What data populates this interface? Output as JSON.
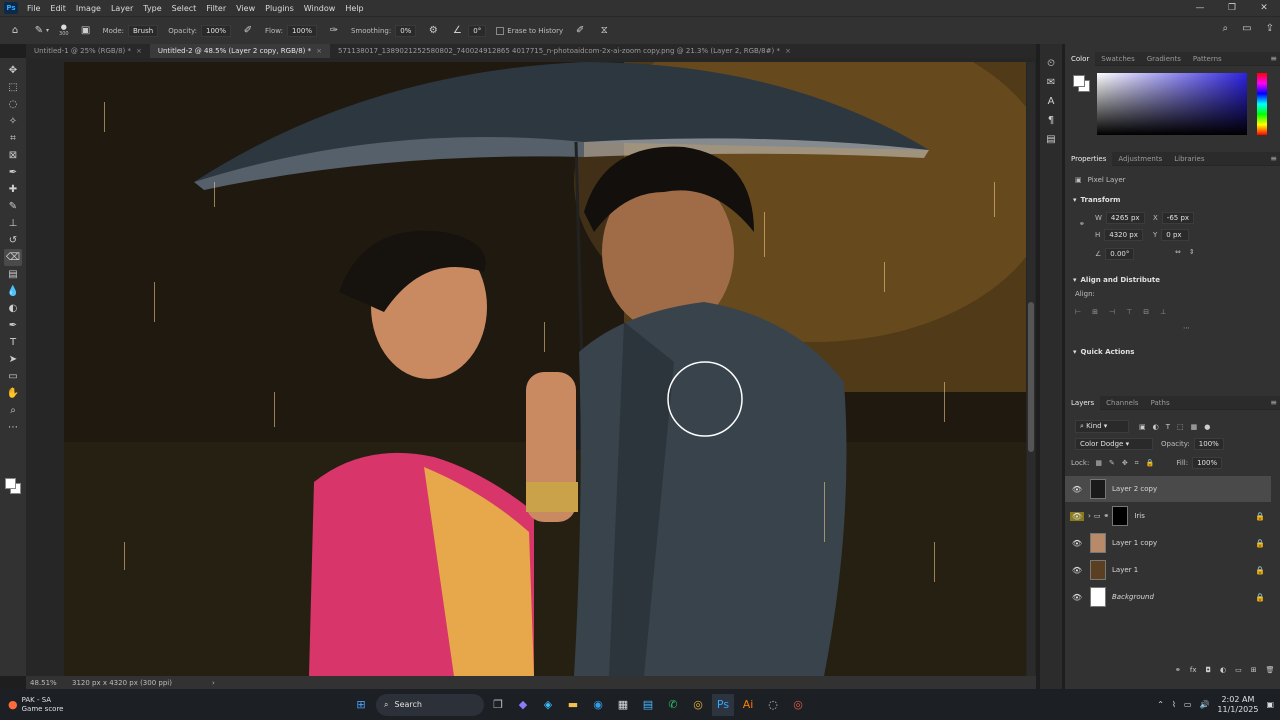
{
  "app": {
    "logo": "Ps"
  },
  "menu": [
    "File",
    "Edit",
    "Image",
    "Layer",
    "Type",
    "Select",
    "Filter",
    "View",
    "Plugins",
    "Window",
    "Help"
  ],
  "options": {
    "brush_size": "300",
    "mode_label": "Mode:",
    "mode_value": "Brush",
    "opacity_label": "Opacity:",
    "opacity_value": "100%",
    "flow_label": "Flow:",
    "flow_value": "100%",
    "smoothing_label": "Smoothing:",
    "smoothing_value": "0%",
    "angle_value": "0°",
    "erase_history_label": "Erase to History"
  },
  "tabs": [
    {
      "label": "Untitled-1 @ 25% (RGB/8) *",
      "active": false
    },
    {
      "label": "Untitled-2 @ 48.5% (Layer 2 copy, RGB/8) *",
      "active": true
    },
    {
      "label": "571138017_1389021252580802_740024912865 4017715_n-photoaidcom-2x-ai-zoom copy.png @ 21.3% (Layer 2, RGB/8#) *",
      "active": false
    }
  ],
  "status": {
    "zoom": "48.51%",
    "doc_info": "3120 px x 4320 px (300 ppi)"
  },
  "color_panel": {
    "tabs": [
      "Color",
      "Swatches",
      "Gradients",
      "Patterns"
    ]
  },
  "properties": {
    "tabs": [
      "Properties",
      "Adjustments",
      "Libraries"
    ],
    "layer_type": "Pixel Layer",
    "transform_label": "Transform",
    "w_label": "W",
    "w_value": "4265 px",
    "x_label": "X",
    "x_value": "-65 px",
    "h_label": "H",
    "h_value": "4320 px",
    "y_label": "Y",
    "y_value": "0 px",
    "angle_value": "0.00°",
    "align_distribute_label": "Align and Distribute",
    "align_label": "Align:",
    "quick_actions_label": "Quick Actions"
  },
  "layers_panel": {
    "tabs": [
      "Layers",
      "Channels",
      "Paths"
    ],
    "filter_kind": "Kind",
    "blend_mode": "Color Dodge",
    "opacity_label": "Opacity:",
    "opacity_value": "100%",
    "lock_label": "Lock:",
    "fill_label": "Fill:",
    "fill_value": "100%",
    "layers": [
      {
        "name": "Layer 2 copy",
        "selected": true,
        "thumb": "#1a1a1a"
      },
      {
        "name": "Iris",
        "selected": false,
        "thumb": "#000000",
        "group": true
      },
      {
        "name": "Layer 1 copy",
        "selected": false,
        "thumb": "#b88a6a"
      },
      {
        "name": "Layer 1",
        "selected": false,
        "thumb": "#5a4020"
      },
      {
        "name": "Background",
        "selected": false,
        "thumb": "#ffffff"
      }
    ]
  },
  "taskbar": {
    "weather_line1": "PAK - SA",
    "weather_line2": "Game score",
    "search_label": "Search",
    "time": "2:02 AM",
    "date": "11/1/2025"
  }
}
